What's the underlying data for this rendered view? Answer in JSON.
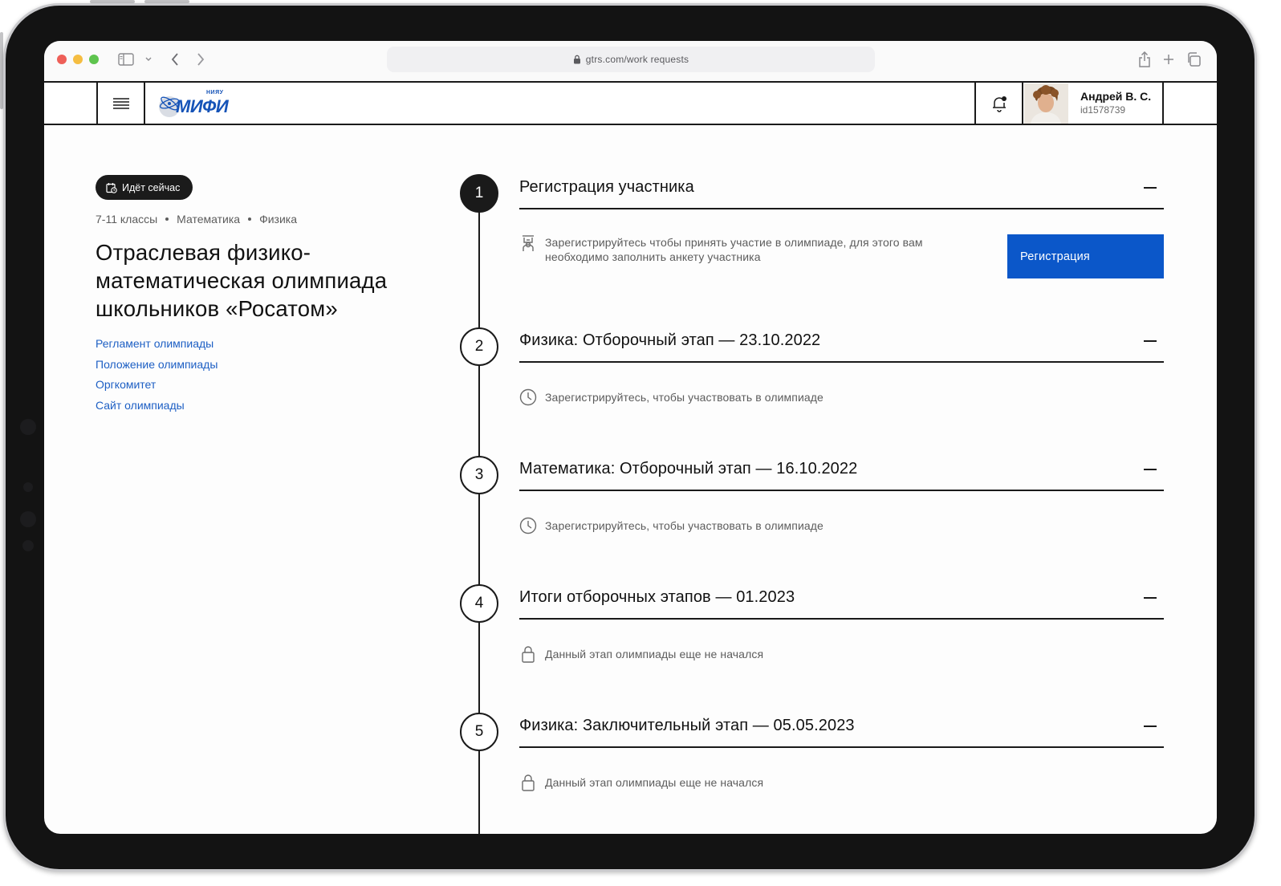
{
  "browser": {
    "url": "gtrs.com/work requests"
  },
  "header": {
    "logo_small": "НИЯУ",
    "logo_big": "МИФИ",
    "user_name": "Андрей В. С.",
    "user_id": "id1578739"
  },
  "olympiad": {
    "status": "Идёт сейчас",
    "meta": [
      "7-11 классы",
      "Математика",
      "Физика"
    ],
    "title": "Отраслевая физико-математическая олимпиада школьников «Росатом»",
    "links": [
      "Регламент олимпиады",
      "Положение олимпиады",
      "Оргкомитет",
      "Сайт олимпиады"
    ]
  },
  "steps": [
    {
      "number": "1",
      "title": "Регистрация участника",
      "icon": "participant-icon",
      "text": "Зарегистрируйтесь чтобы принять участие в олимпиаде, для этого вам необходимо заполнить анкету участника",
      "button": "Регистрация"
    },
    {
      "number": "2",
      "title": "Физика: Отборочный этап — 23.10.2022",
      "icon": "clock-icon",
      "text": "Зарегистрируйтесь, чтобы участвовать в олимпиаде"
    },
    {
      "number": "3",
      "title": "Математика: Отборочный этап — 16.10.2022",
      "icon": "clock-icon",
      "text": "Зарегистрируйтесь, чтобы участвовать в олимпиаде"
    },
    {
      "number": "4",
      "title": "Итоги отборочных этапов — 01.2023",
      "icon": "lock-icon",
      "text": "Данный этап олимпиады еще не начался"
    },
    {
      "number": "5",
      "title": "Физика: Заключительный этап — 05.05.2023",
      "icon": "lock-icon",
      "text": "Данный этап олимпиады еще не начался"
    }
  ],
  "colors": {
    "accent": "#0b57c9",
    "link": "#1d5fc4",
    "dark": "#1a1a1a"
  }
}
